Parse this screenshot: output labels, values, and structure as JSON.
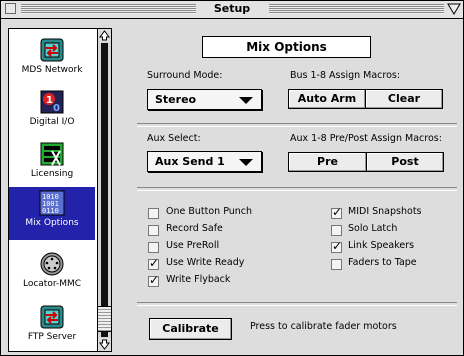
{
  "window": {
    "title": "Setup"
  },
  "sidebar": {
    "items": [
      {
        "label": "MDS Network",
        "icon": "network-icon",
        "selected": false
      },
      {
        "label": "Digital I/O",
        "icon": "digital-io-icon",
        "selected": false
      },
      {
        "label": "Licensing",
        "icon": "licensing-icon",
        "selected": false
      },
      {
        "label": "Mix Options",
        "icon": "mix-options-icon",
        "selected": true
      },
      {
        "label": "Locator-MMC",
        "icon": "locator-mmc-icon",
        "selected": false
      },
      {
        "label": "FTP Server",
        "icon": "ftp-server-icon",
        "selected": false
      }
    ]
  },
  "panel": {
    "heading": "Mix Options",
    "surround_mode_label": "Surround Mode:",
    "surround_mode_value": "Stereo",
    "bus_macros_label": "Bus 1-8 Assign Macros:",
    "auto_arm_label": "Auto Arm",
    "clear_label": "Clear",
    "aux_select_label": "Aux Select:",
    "aux_select_value": "Aux Send 1",
    "aux_macros_label": "Aux 1-8 Pre/Post Assign Macros:",
    "pre_label": "Pre",
    "post_label": "Post",
    "options_left": [
      {
        "label": "One Button Punch",
        "checked": false
      },
      {
        "label": "Record Safe",
        "checked": false
      },
      {
        "label": "Use PreRoll",
        "checked": false
      },
      {
        "label": "Use Write Ready",
        "checked": true
      },
      {
        "label": "Write Flyback",
        "checked": true
      }
    ],
    "options_right": [
      {
        "label": "MIDI Snapshots",
        "checked": true
      },
      {
        "label": "Solo Latch",
        "checked": false
      },
      {
        "label": "Link Speakers",
        "checked": true
      },
      {
        "label": "Faders to Tape",
        "checked": false
      }
    ],
    "calibrate_label": "Calibrate",
    "calibrate_hint": "Press to calibrate fader motors"
  }
}
